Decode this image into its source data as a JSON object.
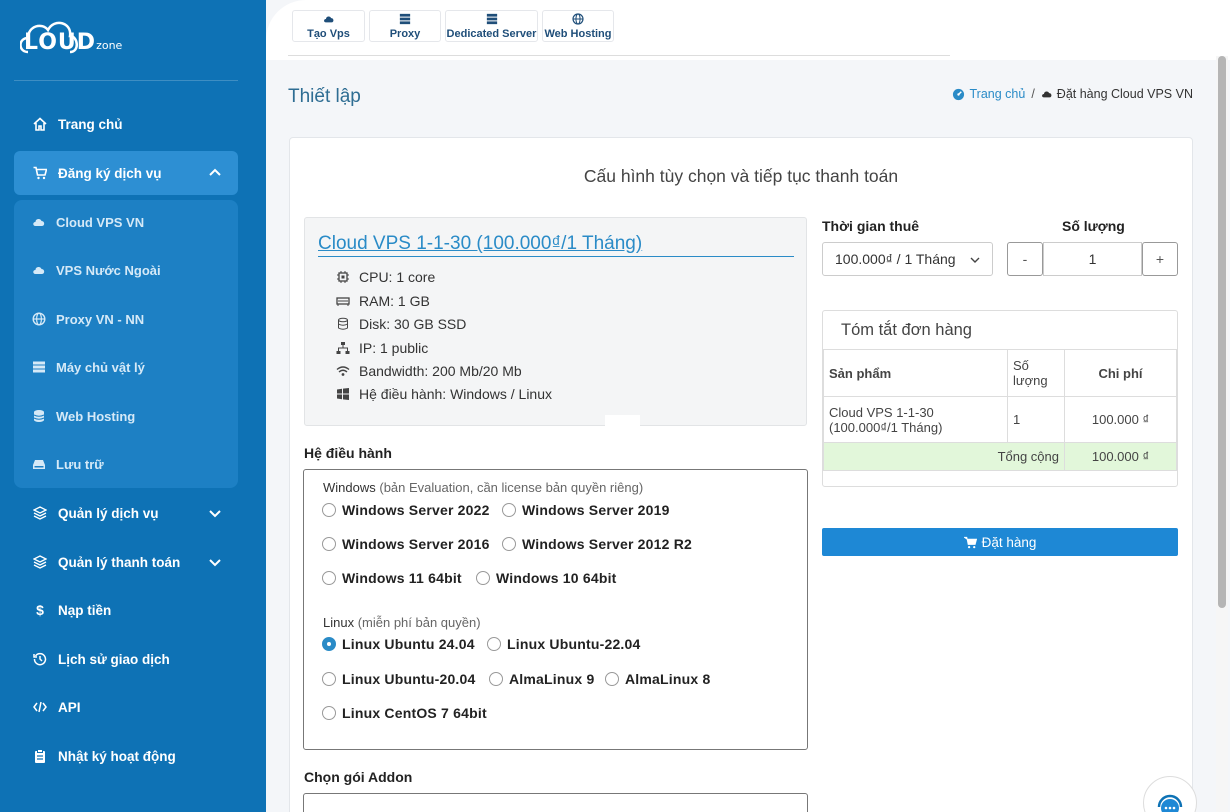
{
  "logo": {
    "text": "LOUD",
    "sub": "zone"
  },
  "sidebar": {
    "items": [
      {
        "label": "Trang chủ",
        "icon": "home-icon"
      },
      {
        "label": "Đăng ký dịch vụ",
        "icon": "cart-icon"
      },
      {
        "label": "Quản lý dịch vụ",
        "icon": "layers-icon"
      },
      {
        "label": "Quản lý thanh toán",
        "icon": "layers-icon"
      },
      {
        "label": "Nạp tiền",
        "icon": "dollar-icon"
      },
      {
        "label": "Lịch sử giao dịch",
        "icon": "history-icon"
      },
      {
        "label": "API",
        "icon": "code-icon"
      },
      {
        "label": "Nhật ký hoạt động",
        "icon": "clipboard-icon"
      }
    ],
    "sub_items": [
      {
        "label": "Cloud VPS VN",
        "icon": "cloud-icon"
      },
      {
        "label": "VPS Nước Ngoài",
        "icon": "cloud-icon"
      },
      {
        "label": "Proxy VN - NN",
        "icon": "globe-icon"
      },
      {
        "label": "Máy chủ vật lý",
        "icon": "server-icon"
      },
      {
        "label": "Web Hosting",
        "icon": "database-icon"
      },
      {
        "label": "Lưu trữ",
        "icon": "hdd-icon"
      }
    ]
  },
  "topnav": [
    {
      "label": "Tạo Vps",
      "icon": "cloud-icon"
    },
    {
      "label": "Proxy",
      "icon": "server-icon"
    },
    {
      "label": "Dedicated Server",
      "icon": "server-icon"
    },
    {
      "label": "Web Hosting",
      "icon": "globe-icon"
    }
  ],
  "page": {
    "title": "Thiết lập"
  },
  "breadcrumb": {
    "home": "Trang chủ",
    "sep": "/",
    "current": "Đặt hàng Cloud VPS VN"
  },
  "card": {
    "title": "Cấu hình tùy chọn và tiếp tục thanh toán"
  },
  "product": {
    "name": "Cloud VPS 1-1-30 (100.000₫/1 Tháng)",
    "specs": [
      {
        "text": "CPU: 1 core",
        "icon": "cpu-icon"
      },
      {
        "text": "RAM: 1 GB",
        "icon": "memory-icon"
      },
      {
        "text": "Disk: 30 GB SSD",
        "icon": "disk-icon"
      },
      {
        "text": "IP: 1 public",
        "icon": "network-icon"
      },
      {
        "text": "Bandwidth: 200 Mb/20 Mb",
        "icon": "wifi-icon"
      },
      {
        "text": "Hệ điều hành: Windows / Linux",
        "icon": "windows-icon"
      }
    ]
  },
  "os": {
    "label": "Hệ điều hành",
    "windows_group": "Windows",
    "windows_note": "(bản Evaluation, cần license bản quyền riêng)",
    "linux_group": "Linux",
    "linux_note": "(miễn phí bản quyền)",
    "windows_options": [
      "Windows Server 2022",
      "Windows Server 2019",
      "Windows Server 2016",
      "Windows Server 2012 R2",
      "Windows 11 64bit",
      "Windows 10 64bit"
    ],
    "linux_options": [
      "Linux Ubuntu 24.04",
      "Linux Ubuntu-22.04",
      "Linux Ubuntu-20.04",
      "AlmaLinux 9",
      "AlmaLinux 8",
      "Linux CentOS 7 64bit"
    ],
    "selected": "Linux Ubuntu 24.04"
  },
  "addon": {
    "label": "Chọn gói Addon"
  },
  "rental": {
    "label": "Thời gian thuê",
    "value": "100.000₫ / 1 Tháng"
  },
  "quantity": {
    "label": "Số lượng",
    "value": "1",
    "minus": "-",
    "plus": "+"
  },
  "summary": {
    "title": "Tóm tắt đơn hàng",
    "headers": [
      "Sản phẩm",
      "Số lượng",
      "Chi phí"
    ],
    "row": {
      "product": "Cloud VPS 1-1-30 (100.000₫/1 Tháng)",
      "qty": "1",
      "cost": "100.000 ₫"
    },
    "total_label": "Tổng cộng",
    "total_value": "100.000 ₫"
  },
  "order_button": "Đặt hàng",
  "colors": {
    "sidebar": "#0e72b5",
    "accent": "#2a8bc7",
    "button": "#1e88d5",
    "total_row": "#e2f7da"
  }
}
